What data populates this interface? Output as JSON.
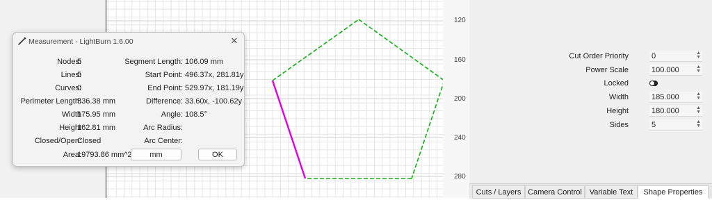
{
  "ruler": {
    "labels": [
      "120",
      "160",
      "200",
      "240",
      "280"
    ]
  },
  "colors": {
    "selected_segment": "#e000e0",
    "shape_outline": "#11b011",
    "grid_minor": "#e6e6e6",
    "grid_major": "#cfcfcf"
  },
  "properties": [
    {
      "label": "Cut Order Priority",
      "value": "0",
      "kind": "spin"
    },
    {
      "label": "Power Scale",
      "value": "100.000",
      "kind": "spin"
    },
    {
      "label": "Locked",
      "value": "",
      "kind": "toggle"
    },
    {
      "label": "Width",
      "value": "185.000",
      "kind": "spin"
    },
    {
      "label": "Height",
      "value": "180.000",
      "kind": "spin"
    },
    {
      "label": "Sides",
      "value": "5",
      "kind": "spin"
    }
  ],
  "tabs": [
    {
      "label": "Cuts / Layers",
      "active": false
    },
    {
      "label": "Camera Control",
      "active": false
    },
    {
      "label": "Variable Text",
      "active": false
    },
    {
      "label": "Shape Properties",
      "active": true
    }
  ],
  "dialog": {
    "title": "Measurement - LightBurn 1.6.00",
    "close_icon": "close-icon",
    "left_fields": [
      {
        "label": "Nodes:",
        "value": "5"
      },
      {
        "label": "Lines:",
        "value": "5"
      },
      {
        "label": "Curves:",
        "value": "0"
      },
      {
        "label": "Perimeter Length:",
        "value": "536.38 mm"
      },
      {
        "label": "Width",
        "value": "175.95 mm"
      },
      {
        "label": "Height",
        "value": "162.81 mm"
      },
      {
        "label": "Closed/Open:",
        "value": "Closed"
      },
      {
        "label": "Area:",
        "value": "19793.86 mm^2"
      }
    ],
    "right_fields": [
      {
        "label": "Segment Length:",
        "value": "106.09 mm"
      },
      {
        "label": "Start Point:",
        "value": "496.37x, 281.81y"
      },
      {
        "label": "End Point:",
        "value": "529.97x, 181.19y"
      },
      {
        "label": "Difference:",
        "value": "33.60x, -100.62y"
      },
      {
        "label": "Angle:",
        "value": "108.5°"
      },
      {
        "label": "Arc Radius:",
        "value": ""
      },
      {
        "label": "Arc Center:",
        "value": ""
      }
    ],
    "units_button": "mm",
    "ok_button": "OK"
  }
}
